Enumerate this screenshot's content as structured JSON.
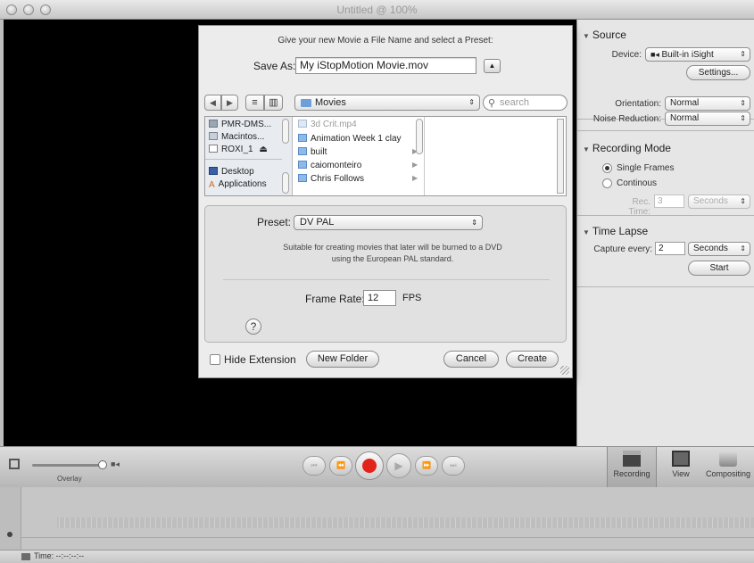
{
  "window": {
    "title": "Untitled @ 100%"
  },
  "dialog": {
    "message": "Give your new Movie a File Name and select a Preset:",
    "save_as_label": "Save As:",
    "save_as_value": "My iStopMotion Movie.mov",
    "expand_glyph": "▲",
    "nav_back": "◀",
    "nav_forward": "▶",
    "view_list": "≡",
    "view_columns": "▥",
    "location": "Movies",
    "search_placeholder": "search",
    "sidebar": [
      {
        "label": "PMR-DMS...",
        "icon": "network-disk-icon"
      },
      {
        "label": "Macintos...",
        "icon": "hard-drive-icon"
      },
      {
        "label": "ROXI_1",
        "icon": "removable-disk-icon",
        "eject": "⏏"
      },
      {
        "label": "Desktop",
        "icon": "desktop-icon"
      },
      {
        "label": "Applications",
        "icon": "applications-icon"
      }
    ],
    "files": [
      {
        "label": "3d Crit.mp4",
        "dimmed": true
      },
      {
        "label": "Animation Week 1 clay",
        "dimmed": false
      },
      {
        "label": "built",
        "dimmed": false
      },
      {
        "label": "caiomonteiro",
        "dimmed": false
      },
      {
        "label": "Chris Follows",
        "dimmed": false
      }
    ],
    "preset_label": "Preset:",
    "preset_value": "DV PAL",
    "preset_desc_line1": "Suitable for creating movies that later will be burned to a DVD",
    "preset_desc_line2": "using the European PAL standard.",
    "frame_rate_label": "Frame Rate:",
    "frame_rate_value": "12",
    "fps_label": "FPS",
    "help_label": "?",
    "hide_extension_label": "Hide Extension",
    "hide_extension_checked": false,
    "new_folder_label": "New Folder",
    "cancel_label": "Cancel",
    "create_label": "Create"
  },
  "panel": {
    "source": {
      "title": "Source",
      "device_label": "Device:",
      "device_value": "Built-in iSight",
      "settings_label": "Settings...",
      "orientation_label": "Orientation:",
      "orientation_value": "Normal",
      "noise_label": "Noise Reduction:",
      "noise_value": "Normal"
    },
    "recording_mode": {
      "title": "Recording Mode",
      "single_frames": "Single Frames",
      "continous": "Continous",
      "selected": "single_frames",
      "rec_time_label": "Rec. Time:",
      "rec_time_value": "3",
      "rec_time_unit": "Seconds"
    },
    "time_lapse": {
      "title": "Time Lapse",
      "capture_label": "Capture every:",
      "capture_value": "2",
      "capture_unit": "Seconds",
      "start_label": "Start"
    }
  },
  "controls": {
    "overlay_label": "Overlay",
    "transport": [
      "⏮",
      "⏪",
      "⏺",
      "▶",
      "⏩",
      "⏭"
    ],
    "modes": [
      {
        "label": "Recording",
        "active": true
      },
      {
        "label": "View",
        "active": false
      },
      {
        "label": "Compositing",
        "active": false
      }
    ]
  },
  "status": {
    "time_text": "Time: --:--:--:--"
  },
  "colors": {
    "record": "#e2231a",
    "video_bg": "#000000",
    "panel_bg": "#e6e6e6"
  }
}
